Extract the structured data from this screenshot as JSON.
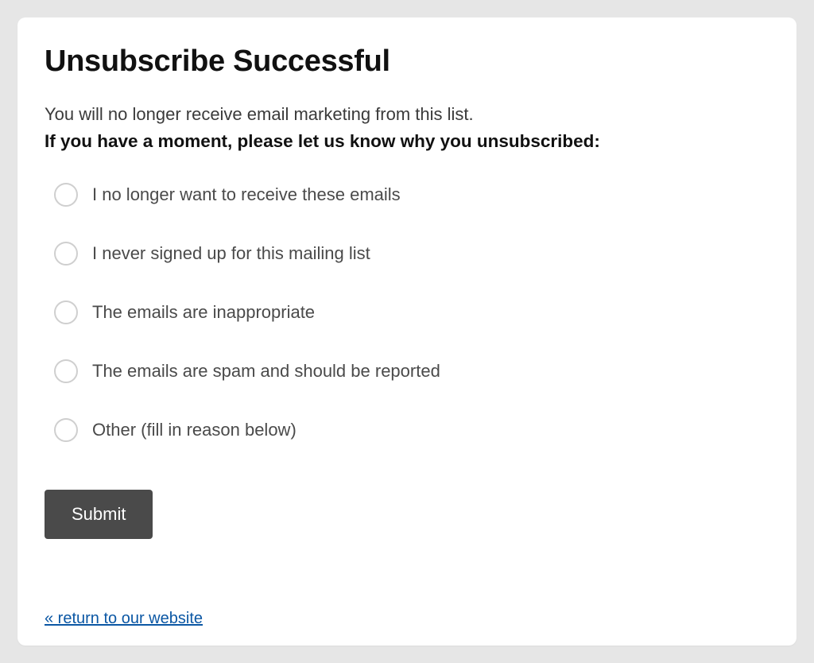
{
  "header": {
    "title": "Unsubscribe Successful"
  },
  "body": {
    "subtext": "You will no longer receive email marketing from this list.",
    "prompt": "If you have a moment, please let us know why you unsubscribed:"
  },
  "options": [
    {
      "label": "I no longer want to receive these emails"
    },
    {
      "label": "I never signed up for this mailing list"
    },
    {
      "label": "The emails are inappropriate"
    },
    {
      "label": "The emails are spam and should be reported"
    },
    {
      "label": "Other (fill in reason below)"
    }
  ],
  "actions": {
    "submit_label": "Submit",
    "return_link_label": "« return to our website"
  }
}
